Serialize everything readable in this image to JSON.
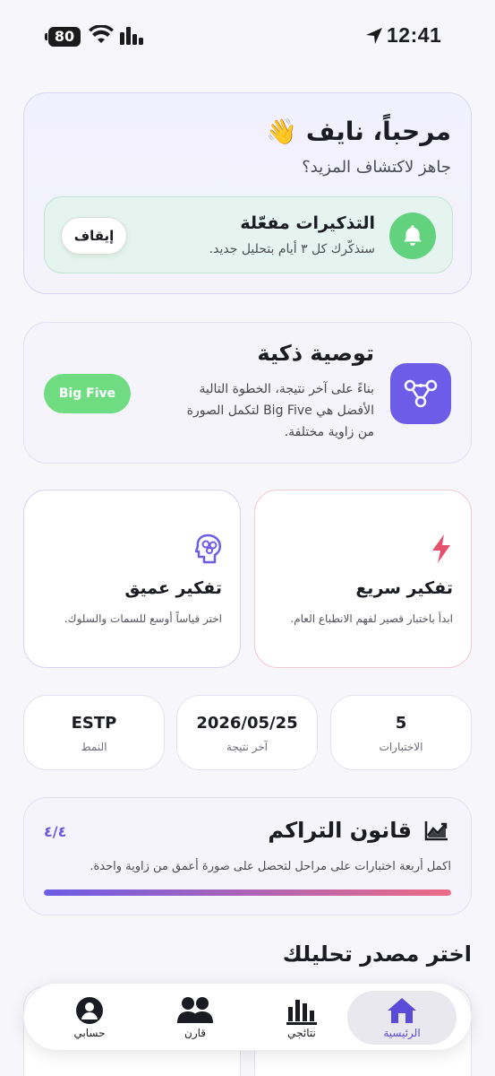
{
  "status_bar": {
    "battery": "80",
    "time": "12:41"
  },
  "welcome": {
    "title": "مرحباً، نايف 👋",
    "subtitle": "جاهز لاكتشاف المزيد؟",
    "reminder": {
      "title": "التذكيرات مفعّلة",
      "subtitle": "سنذكّرك كل ٣ أيام بتحليل جديد.",
      "button": "إيقاف",
      "icon": "bell-icon"
    }
  },
  "recommendation": {
    "title": "توصية ذكية",
    "text": "بناءً على آخر نتيجة، الخطوة التالية الأفضل هي Big Five لتكمل الصورة من زاوية مختلفة.",
    "button": "Big Five",
    "icon": "nodes-icon"
  },
  "thinking": {
    "fast": {
      "title": "تفكير سريع",
      "subtitle": "ابدأ باختبار قصير لفهم الانطباع العام.",
      "icon": "lightning-icon"
    },
    "deep": {
      "title": "تفكير عميق",
      "subtitle": "اختر قياساً أوسع للسمات والسلوك.",
      "icon": "brain-icon"
    }
  },
  "stats": [
    {
      "value": "5",
      "label": "الاختبارات"
    },
    {
      "value": "2026/05/25",
      "label": "آخر نتيجة"
    },
    {
      "value": "ESTP",
      "label": "النمط"
    }
  ],
  "accumulation": {
    "title": "قانون التراكم",
    "count": "٤/٤",
    "subtitle": "اكمل أربعة اختبارات على مراحل لتحصل على صورة أعمق من زاوية واحدة.",
    "progress": 1.0,
    "icon": "chart-trend-icon"
  },
  "section_title": "اختر مصدر تحليلك",
  "nav": [
    {
      "label": "الرئيسية",
      "icon": "home-icon",
      "active": true
    },
    {
      "label": "نتائجي",
      "icon": "bar-chart-icon",
      "active": false
    },
    {
      "label": "قارن",
      "icon": "people-icon",
      "active": false
    },
    {
      "label": "حسابي",
      "icon": "profile-icon",
      "active": false
    }
  ],
  "colors": {
    "accent": "#6d5ce8",
    "green": "#62d27f",
    "pink": "#e8516e"
  }
}
